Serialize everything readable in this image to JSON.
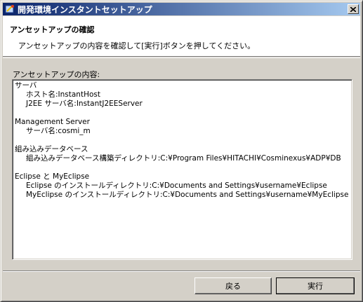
{
  "window": {
    "title": "開発環境インスタントセットアップ"
  },
  "header": {
    "title": "アンセットアップの確認",
    "description": "アンセットアップの内容を確認して[実行]ボタンを押してください。"
  },
  "content": {
    "label": "アンセットアップの内容:",
    "lines": [
      "サーバ",
      "ホスト名:InstantHost",
      "J2EE サーバ名:InstantJ2EEServer",
      "Management Server",
      "サーバ名:cosmi_m",
      "組み込みデータベース",
      "組み込みデータベース構築ディレクトリ:C:¥Program Files¥HITACHI¥Cosminexus¥ADP¥DB",
      "Eclipse と MyEclipse",
      "Eclipse のインストールディレクトリ:C:¥Documents and Settings¥username¥Eclipse",
      "MyEclipse のインストールディレクトリ:C:¥Documents and Settings¥username¥MyEclipse"
    ]
  },
  "buttons": {
    "back": "戻る",
    "run": "実行"
  },
  "colors": {
    "title_start": "#0a246a",
    "title_end": "#a6caf0",
    "face": "#d4d0c8"
  },
  "icons": {
    "app": "setup-app-icon",
    "close": "close-icon"
  }
}
